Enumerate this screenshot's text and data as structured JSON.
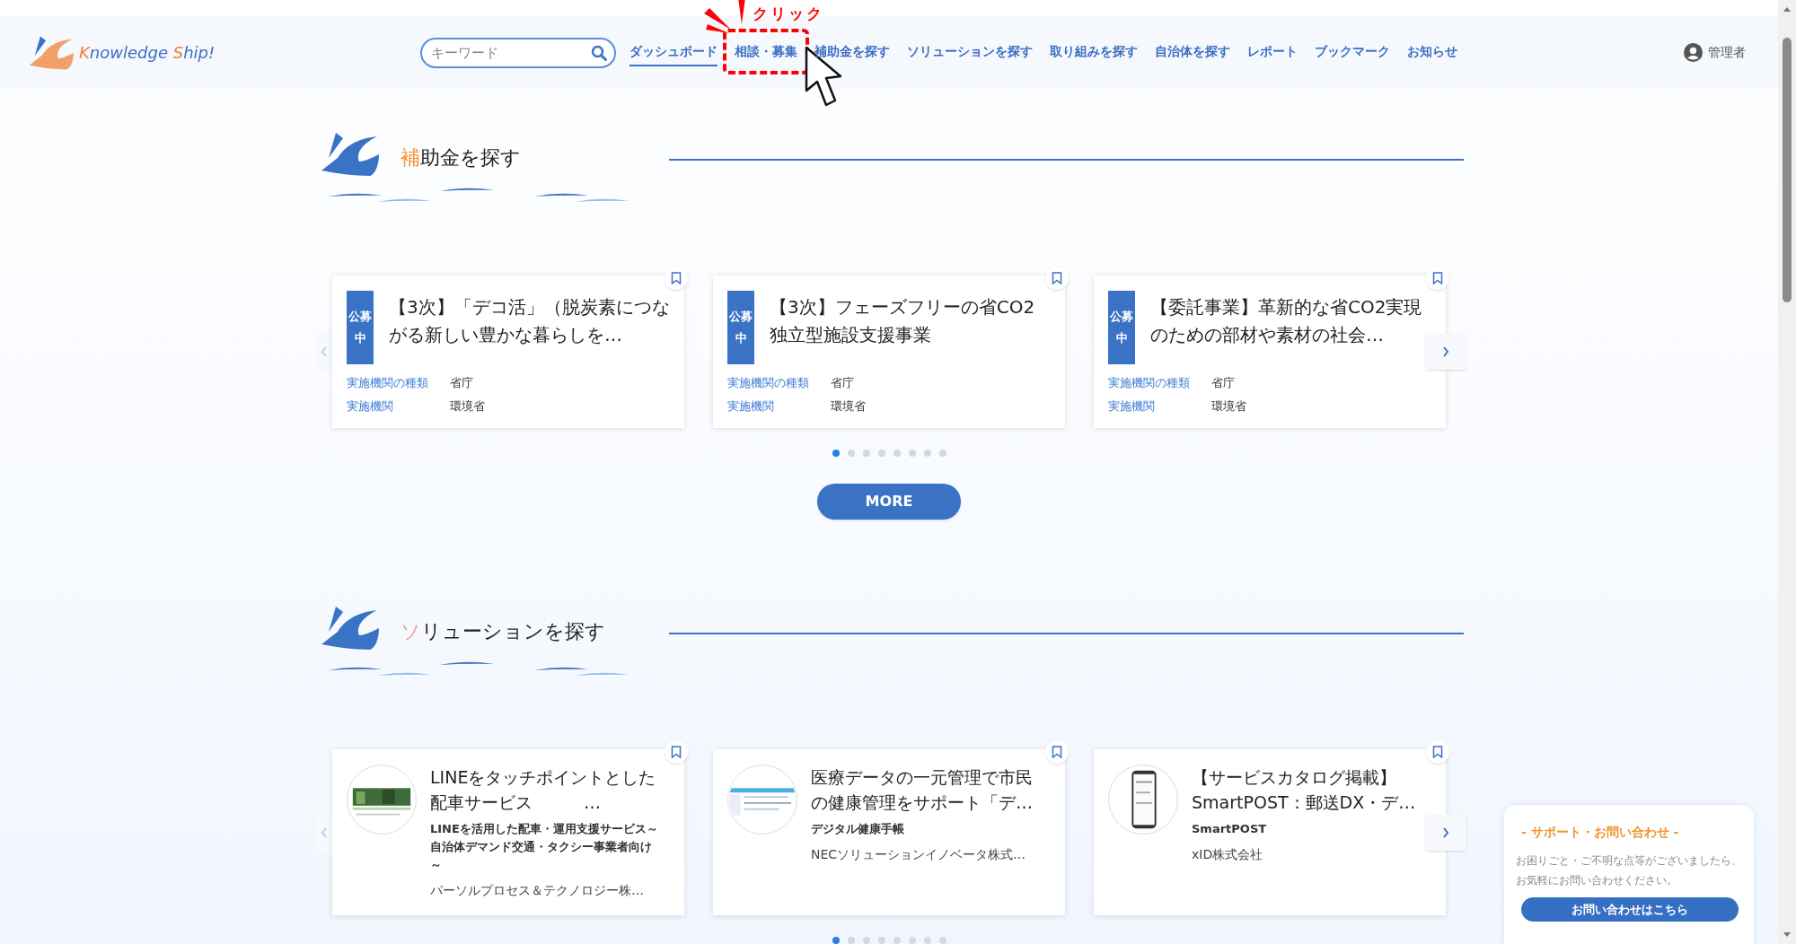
{
  "header": {
    "logo_text": "Knowledge Ship!",
    "search": {
      "placeholder": "キーワード"
    },
    "nav": [
      {
        "label": "ダッシュボード",
        "selected": true,
        "annotated": false
      },
      {
        "label": "相談・募集",
        "selected": false,
        "annotated": true
      },
      {
        "label": "補助金を探す",
        "selected": false,
        "annotated": false
      },
      {
        "label": "ソリューションを探す",
        "selected": false,
        "annotated": false
      },
      {
        "label": "取り組みを探す",
        "selected": false,
        "annotated": false
      },
      {
        "label": "自治体を探す",
        "selected": false,
        "annotated": false
      },
      {
        "label": "レポート",
        "selected": false,
        "annotated": false
      },
      {
        "label": "ブックマーク",
        "selected": false,
        "annotated": false
      },
      {
        "label": "お知らせ",
        "selected": false,
        "annotated": false
      }
    ],
    "annotation": {
      "text": "クリック"
    },
    "user": "管理者"
  },
  "sections": [
    {
      "title": "補助金を探す",
      "kind": "subsidy",
      "prev_disabled": true,
      "cards": [
        {
          "badge": "公募中",
          "title": "【3次】「デコ活」（脱炭素につながる新しい豊かな暮らしを…",
          "bookmarked": false,
          "fields": [
            {
              "label": "実施機関の種類",
              "value": "省庁"
            },
            {
              "label": "実施機関",
              "value": "環境省"
            }
          ]
        },
        {
          "badge": "公募中",
          "title": "【3次】フェーズフリーの省CO2独立型施設支援事業",
          "bookmarked": false,
          "fields": [
            {
              "label": "実施機関の種類",
              "value": "省庁"
            },
            {
              "label": "実施機関",
              "value": "環境省"
            }
          ]
        },
        {
          "badge": "公募中",
          "title": "【委託事業】革新的な省CO2実現のための部材や素材の社会…",
          "bookmarked": false,
          "fields": [
            {
              "label": "実施機関の種類",
              "value": "省庁"
            },
            {
              "label": "実施機関",
              "value": "環境省"
            }
          ]
        }
      ],
      "dots": [
        {
          "selected": true
        },
        {
          "selected": false
        },
        {
          "selected": false
        },
        {
          "selected": false
        },
        {
          "selected": false
        },
        {
          "selected": false
        },
        {
          "selected": false
        },
        {
          "selected": false
        }
      ],
      "more": "MORE"
    },
    {
      "title": "ソリューションを探す",
      "kind": "solution",
      "prev_disabled": true,
      "cards": [
        {
          "title": "LINEをタッチポイントとした配車サービス　　　…",
          "subtitle": "LINEを活用した配車・運用支援サービス～自治体デマンド交通・タクシー事業者向け～",
          "org": "パーソルプロセス＆テクノロジー株…",
          "bookmarked": false
        },
        {
          "title": "医療データの一元管理で市民の健康管理をサポート「デ…",
          "subtitle": "デジタル健康手帳",
          "org": "NECソリューションイノベータ株式…",
          "bookmarked": false
        },
        {
          "title": "【サービスカタログ掲載】SmartPOST：郵送DX・デ…",
          "subtitle": "SmartPOST",
          "org": "xID株式会社",
          "bookmarked": false
        }
      ],
      "dots": [
        {
          "selected": true
        },
        {
          "selected": false
        },
        {
          "selected": false
        },
        {
          "selected": false
        },
        {
          "selected": false
        },
        {
          "selected": false
        },
        {
          "selected": false
        },
        {
          "selected": false
        }
      ]
    }
  ],
  "support": {
    "title": "- サポート・お問い合わせ -",
    "text": "お困りごと・ご不明な点等がございましたら、お気軽にお問い合わせください。",
    "button": "お問い合わせはこちら"
  }
}
